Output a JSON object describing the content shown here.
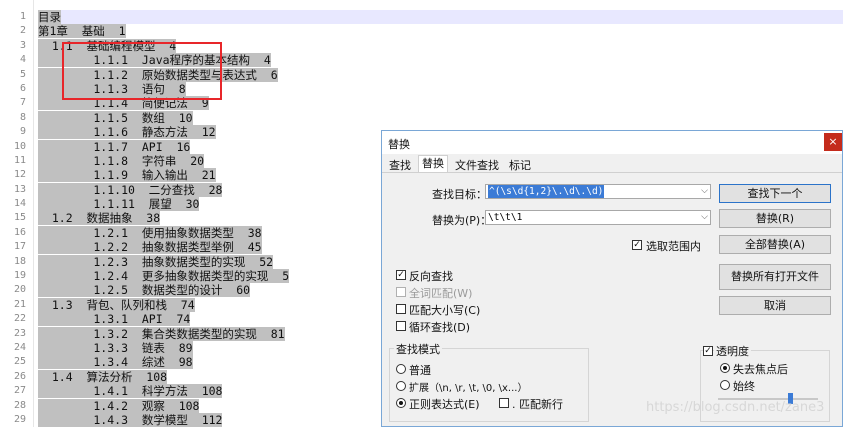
{
  "editor": {
    "line_numbers": [
      "1",
      "2",
      "3",
      "4",
      "5",
      "6",
      "7",
      "8",
      "9",
      "10",
      "11",
      "12",
      "13",
      "14",
      "15",
      "16",
      "17",
      "18",
      "19",
      "20",
      "21",
      "22",
      "23",
      "24",
      "25",
      "26",
      "27",
      "28",
      "29"
    ],
    "lines": [
      "目录",
      "第1章  基础  1",
      "  1.1  基础编程模型  4",
      "        1.1.1  Java程序的基本结构  4",
      "        1.1.2  原始数据类型与表达式  6",
      "        1.1.3  语句  8",
      "        1.1.4  简便记法  9",
      "        1.1.5  数组  10",
      "        1.1.6  静态方法  12",
      "        1.1.7  API  16",
      "        1.1.8  字符串  20",
      "        1.1.9  输入输出  21",
      "        1.1.10  二分查找  28",
      "        1.1.11  展望  30",
      "  1.2  数据抽象  38",
      "        1.2.1  使用抽象数据类型  38",
      "        1.2.2  抽象数据类型举例  45",
      "        1.2.3  抽象数据类型的实现  52",
      "        1.2.4  更多抽象数据类型的实现  5",
      "        1.2.5  数据类型的设计  60",
      "  1.3  背包、队列和栈  74",
      "        1.3.1  API  74",
      "        1.3.2  集合类数据类型的实现  81",
      "        1.3.3  链表  89",
      "        1.3.4  综述  98",
      "  1.4  算法分析  108",
      "        1.4.1  科学方法  108",
      "        1.4.2  观察  108",
      "        1.4.3  数学模型  112"
    ]
  },
  "dialog": {
    "title": "替换",
    "close": "×",
    "tabs": [
      "查找",
      "替换",
      "文件查找",
      "标记"
    ],
    "find_label": "查找目标：",
    "find_value": "^(\\s\\d{1,2}\\.\\d\\.\\d)",
    "replace_label": "替换为(P)：",
    "replace_value": "\\t\\t\\1",
    "in_selection": "选取范围内",
    "buttons": {
      "find_next": "查找下一个",
      "replace": "替换(R)",
      "replace_all": "全部替换(A)",
      "replace_all_open": "替换所有打开文件",
      "cancel": "取消"
    },
    "options": {
      "backward": "反向查找",
      "whole_word": "全词匹配(W)",
      "match_case": "匹配大小写(C)",
      "wrap": "循环查找(D)"
    },
    "search_mode": {
      "title": "查找模式",
      "normal": "普通",
      "extended": "扩展（\\n, \\r, \\t, \\0, \\x...）",
      "regex": "正则表达式(E)",
      "dot_newline": ". 匹配新行"
    },
    "transparency": {
      "title": "透明度",
      "on_lose_focus": "失去焦点后",
      "always": "始终",
      "level": 0.72
    }
  },
  "watermark": "https://blog.csdn.net/zane3"
}
